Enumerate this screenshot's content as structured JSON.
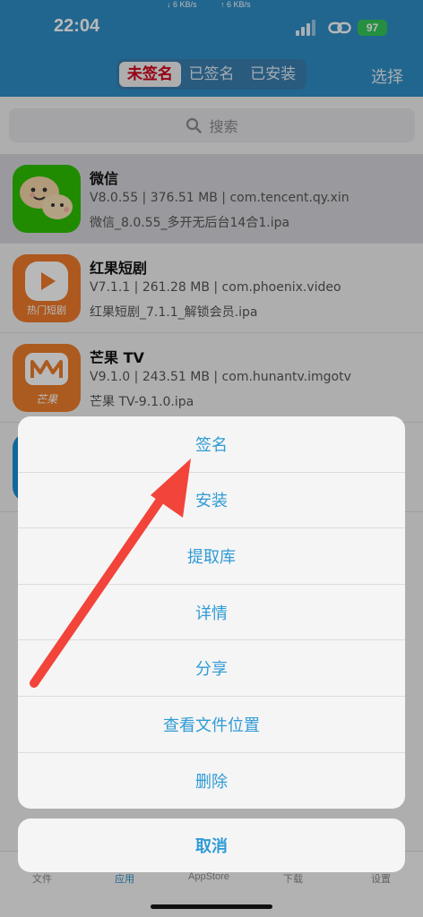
{
  "status": {
    "time": "22:04",
    "down_speed": "↓ 6 KB/s",
    "up_speed": "↑ 6 KB/s",
    "battery": "97"
  },
  "header": {
    "segments": [
      "未签名",
      "已签名",
      "已安装"
    ],
    "active_segment": "未签名",
    "select_label": "选择"
  },
  "search": {
    "placeholder": "搜索"
  },
  "apps": [
    {
      "name": "微信",
      "meta": "V8.0.55 | 376.51 MB | com.tencent.qy.xin",
      "file": "微信_8.0.55_多开无后台14合1.ipa"
    },
    {
      "name": "红果短剧",
      "meta": "V7.1.1 | 261.28 MB | com.phoenix.video",
      "file": "红果短剧_7.1.1_解锁会员.ipa",
      "icon_text": "热门短剧"
    },
    {
      "name": "芒果 TV",
      "meta": "V9.1.0 | 243.51 MB | com.hunantv.imgotv",
      "file": "芒果 TV-9.1.0.ipa",
      "icon_text": "芒果"
    }
  ],
  "action_sheet": {
    "items": [
      "签名",
      "安装",
      "提取库",
      "详情",
      "分享",
      "查看文件位置",
      "删除"
    ],
    "cancel": "取消"
  },
  "tabbar": {
    "tabs": [
      "文件",
      "应用",
      "AppStore",
      "下载",
      "设置"
    ]
  },
  "colors": {
    "header": "#2f8ec6",
    "accent_action": "#2f9bd6",
    "active_segment_text": "#d0021b",
    "arrow": "#f2443a"
  }
}
